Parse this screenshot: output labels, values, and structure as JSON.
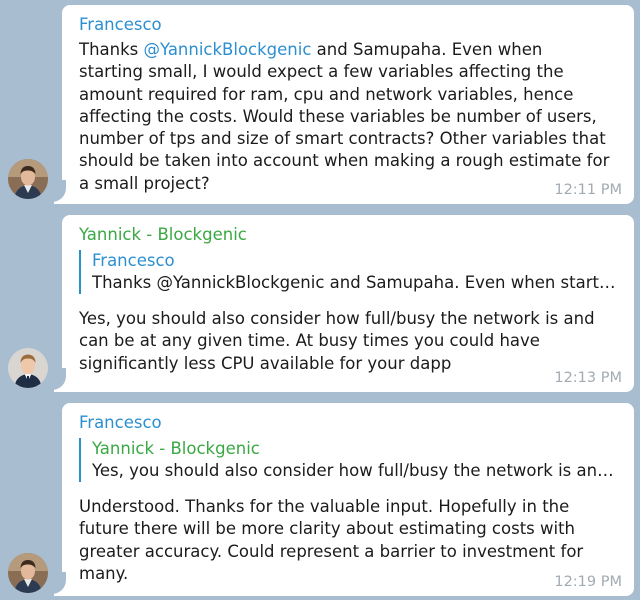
{
  "messages": [
    {
      "sender": "Francesco",
      "text_before_mention": "Thanks ",
      "mention": "@YannickBlockgenic",
      "text_after_mention": " and Samupaha. Even when starting small, I would expect a few variables affecting the amount required for ram, cpu and network variables, hence affecting the costs. Would these variables be number of users, number of tps and size of smart contracts? Other variables that should be taken into account when making a rough estimate for a small project?",
      "time": "12:11 PM"
    },
    {
      "sender": "Yannick - Blockgenic",
      "reply": {
        "name": "Francesco",
        "text": "Thanks @YannickBlockgenic and Samupaha. Even when starting…"
      },
      "text": "Yes, you should also consider how full/busy the network is and can be at any given time. At busy times you could have significantly less CPU available for your dapp",
      "time": "12:13 PM"
    },
    {
      "sender": "Francesco",
      "reply": {
        "name": "Yannick - Blockgenic",
        "text": "Yes, you should also consider how full/busy the network is and c…"
      },
      "text": "Understood. Thanks for the valuable input. Hopefully in the future there will be more clarity about estimating costs with greater accuracy. Could represent a barrier to investment for many.",
      "time": "12:19 PM"
    }
  ],
  "colors": {
    "background": "#a9bdd0",
    "link_blue": "#2b8fd0",
    "sender_green": "#3aa843",
    "time_gray": "#a2abb3"
  },
  "icons": {
    "avatar_francesco": "avatar-francesco-icon",
    "avatar_yannick": "avatar-yannick-icon"
  }
}
